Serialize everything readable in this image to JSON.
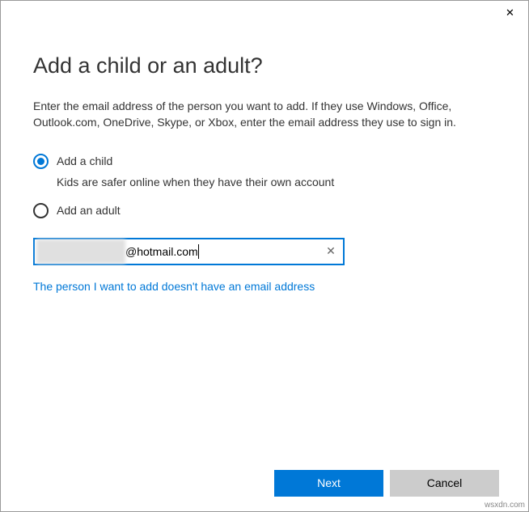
{
  "window": {
    "close_glyph": "✕"
  },
  "heading": "Add a child or an adult?",
  "description": "Enter the email address of the person you want to add. If they use Windows, Office, Outlook.com, OneDrive, Skype, or Xbox, enter the email address they use to sign in.",
  "options": {
    "child": {
      "label": "Add a child",
      "hint": "Kids are safer online when they have their own account",
      "selected": true
    },
    "adult": {
      "label": "Add an adult",
      "selected": false
    }
  },
  "email": {
    "visible_value": "@hotmail.com",
    "clear_glyph": "✕"
  },
  "no_email_link": "The person I want to add doesn't have an email address",
  "buttons": {
    "next": "Next",
    "cancel": "Cancel"
  },
  "attribution": "wsxdn.com"
}
